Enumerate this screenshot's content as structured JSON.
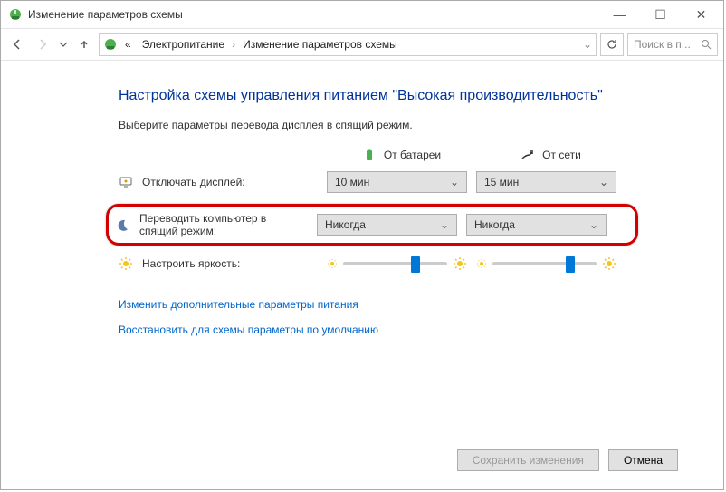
{
  "window": {
    "title": "Изменение параметров схемы"
  },
  "breadcrumb": {
    "prefix": "«",
    "item1": "Электропитание",
    "item2": "Изменение параметров схемы"
  },
  "search": {
    "placeholder": "Поиск в п..."
  },
  "heading": "Настройка схемы управления питанием \"Высокая производительность\"",
  "subtext": "Выберите параметры перевода дисплея в спящий режим.",
  "columns": {
    "battery": "От батареи",
    "plugged": "От сети"
  },
  "rows": {
    "display": {
      "label": "Отключать дисплей:",
      "battery": "10 мин",
      "plugged": "15 мин"
    },
    "sleep": {
      "label": "Переводить компьютер в спящий режим:",
      "battery": "Никогда",
      "plugged": "Никогда"
    },
    "brightness": {
      "label": "Настроить яркость:"
    }
  },
  "links": {
    "advanced": "Изменить дополнительные параметры питания",
    "restore": "Восстановить для схемы параметры по умолчанию"
  },
  "buttons": {
    "save": "Сохранить изменения",
    "cancel": "Отмена"
  }
}
